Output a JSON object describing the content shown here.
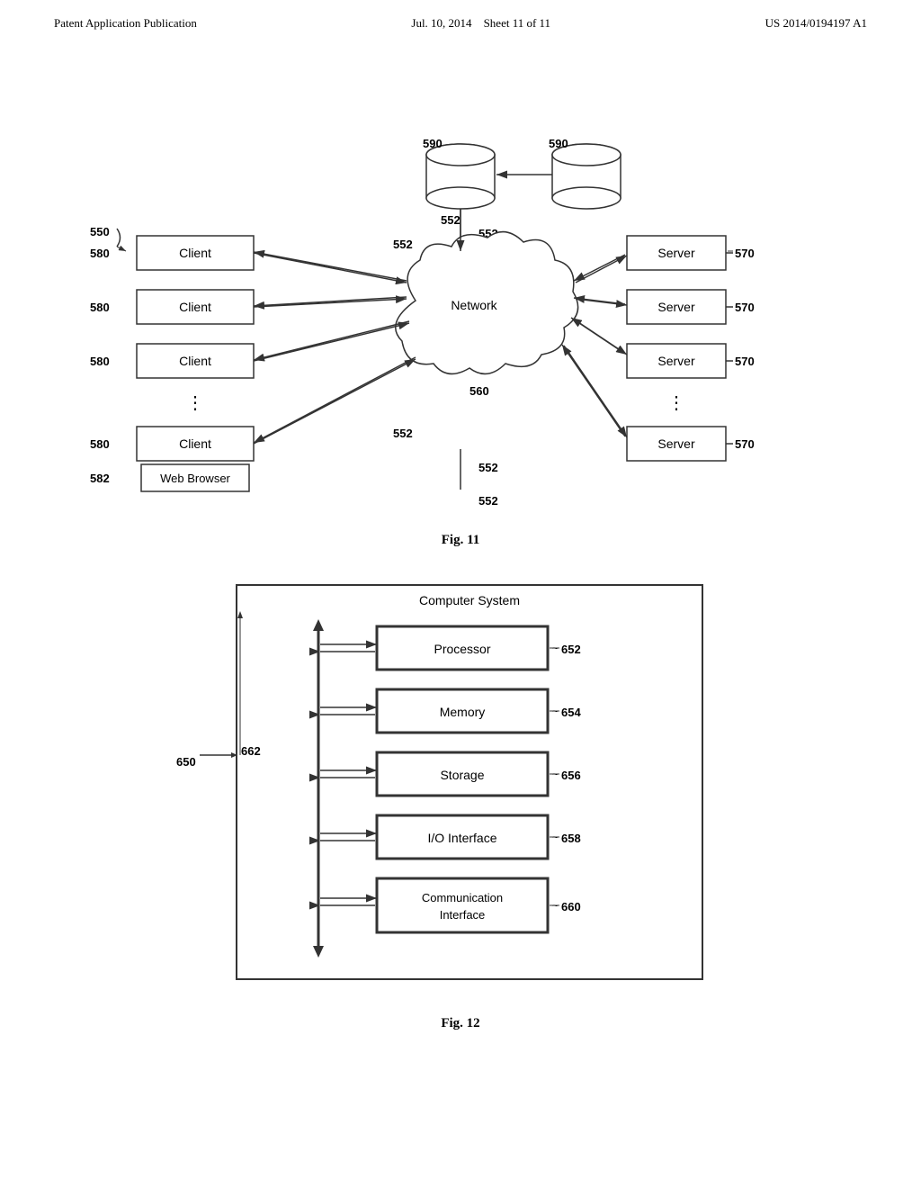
{
  "header": {
    "left": "Patent Application Publication",
    "center_date": "Jul. 10, 2014",
    "center_sheet": "Sheet 11 of 11",
    "right": "US 2014/0194197 A1"
  },
  "fig11": {
    "caption": "Fig. 11",
    "labels": {
      "550": "550",
      "552a": "552",
      "552b": "552",
      "552c": "552",
      "552d": "552",
      "552e": "552",
      "560": "560",
      "570a": "570",
      "570b": "570",
      "570c": "570",
      "570d": "570",
      "580a": "580",
      "580b": "580",
      "580c": "580",
      "580d": "580",
      "582": "582",
      "590a": "590",
      "590b": "590"
    },
    "boxes": {
      "client1": "Client",
      "client2": "Client",
      "client3": "Client",
      "client4": "Client",
      "web_browser": "Web Browser",
      "server1": "Server",
      "server2": "Server",
      "server3": "Server",
      "server4": "Server",
      "network": "Network"
    }
  },
  "fig12": {
    "caption": "Fig. 12",
    "title": "Computer System",
    "labels": {
      "650": "650",
      "652": "652",
      "654": "654",
      "656": "656",
      "658": "658",
      "660": "660",
      "662": "662"
    },
    "components": [
      {
        "id": "processor",
        "label": "Processor",
        "ref": "652"
      },
      {
        "id": "memory",
        "label": "Memory",
        "ref": "654"
      },
      {
        "id": "storage",
        "label": "Storage",
        "ref": "656"
      },
      {
        "id": "io-interface",
        "label": "I/O Interface",
        "ref": "658"
      },
      {
        "id": "comm-interface",
        "label": "Communication\nInterface",
        "ref": "660"
      }
    ]
  }
}
